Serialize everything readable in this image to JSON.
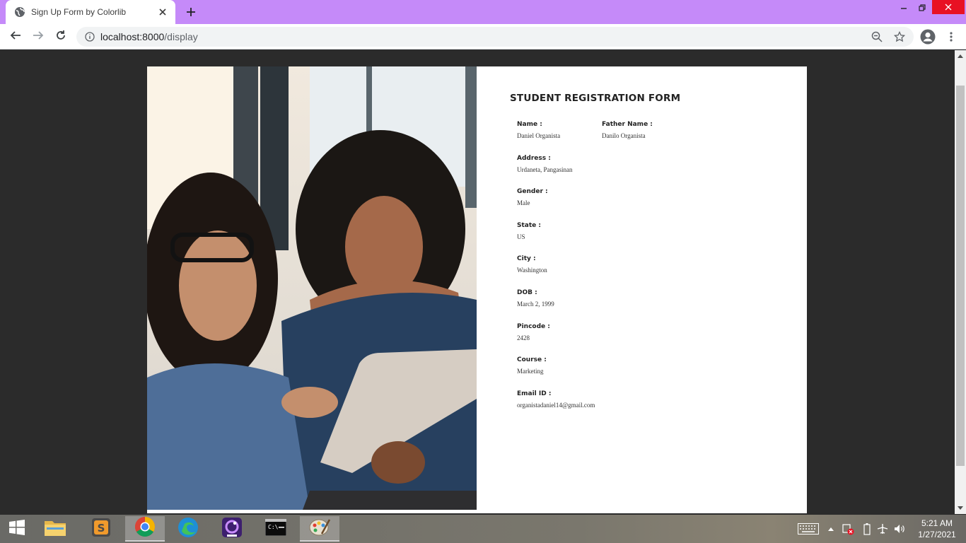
{
  "browser": {
    "tab_title": "Sign Up Form by Colorlib",
    "url_host": "localhost:8000",
    "url_path": "/display"
  },
  "form": {
    "title": "STUDENT REGISTRATION FORM",
    "name_label": "Name :",
    "name_value": "Daniel Organista",
    "father_label": "Father Name :",
    "father_value": "Danilo Organista",
    "address_label": "Address :",
    "address_value": "Urdaneta, Pangasinan",
    "gender_label": "Gender :",
    "gender_value": "Male",
    "state_label": "State :",
    "state_value": "US",
    "city_label": "City :",
    "city_value": "Washington",
    "dob_label": "DOB :",
    "dob_value": "March 2, 1999",
    "pincode_label": "Pincode :",
    "pincode_value": "2428",
    "course_label": "Course :",
    "course_value": "Marketing",
    "email_label": "Email ID :",
    "email_value": "organistadaniel14@gmail.com"
  },
  "taskbar": {
    "apps": [
      "file-explorer",
      "sublime-text",
      "chrome",
      "edge",
      "app-purple",
      "command-prompt",
      "paint"
    ],
    "clock_time": "5:21 AM",
    "clock_date": "1/27/2021"
  },
  "colors": {
    "tabstrip": "#c58af9",
    "close": "#e81123"
  }
}
